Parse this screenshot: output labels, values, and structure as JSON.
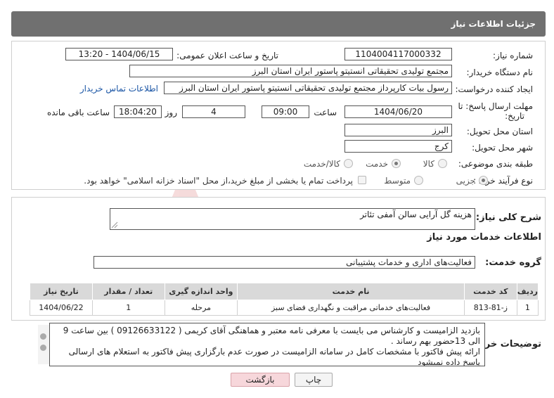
{
  "header": {
    "title": "جزئیات اطلاعات نیاز"
  },
  "form": {
    "need_number_label": "شماره نیاز:",
    "need_number": "1104004117000332",
    "announce_label": "تاریخ و ساعت اعلان عمومی:",
    "announce_value": "1404/06/15 - 13:20",
    "buyer_org_label": "نام دستگاه خریدار:",
    "buyer_org": "مجتمع تولیدی تحقیقاتی انستیتو پاستور ایران استان البرز",
    "requester_label": "ایجاد کننده درخواست:",
    "requester": "رسول بیات کارپرداز مجتمع تولیدی تحقیقاتی انستیتو پاستور ایران استان البرز",
    "contact_link": "اطلاعات تماس خریدار",
    "deadline_label_1": "مهلت ارسال پاسخ: تا",
    "deadline_label_2": "تاریخ:",
    "deadline_date": "1404/06/20",
    "time_label": "ساعت",
    "deadline_time": "09:00",
    "days_value": "4",
    "days_label": "روز و",
    "remaining_time": "18:04:20",
    "remaining_label": "ساعت باقی مانده",
    "province_label": "استان محل تحویل:",
    "province": "البرز",
    "city_label": "شهر محل تحویل:",
    "city": "کرج",
    "category_label": "طبقه بندی موضوعی:",
    "category_options": [
      "کالا",
      "خدمت",
      "کالا/خدمت"
    ],
    "category_selected": "خدمت",
    "process_label": "نوع فرآیند خرید :",
    "process_options": [
      "جزیی",
      "متوسط"
    ],
    "process_selected": "جزیی",
    "payment_note": "پرداخت تمام یا بخشی از مبلغ خرید،از محل \"اسناد خزانه اسلامی\" خواهد بود."
  },
  "summary": {
    "label": "شرح کلی نیاز:",
    "value": "هزینه گل آرایی سالن آمفی تئاتر"
  },
  "services": {
    "section_title": "اطلاعات خدمات مورد نیاز",
    "group_label": "گروه خدمت:",
    "group_value": "فعالیت‌های اداری و خدمات پشتیبانی",
    "columns": [
      "ردیف",
      "کد خدمت",
      "نام خدمت",
      "واحد اندازه گیری",
      "تعداد / مقدار",
      "تاریخ نیاز"
    ],
    "rows": [
      [
        "1",
        "ز-81-813",
        "فعالیت‌های خدماتی مراقبت و نگهداری فضای سبز",
        "مرحله",
        "1",
        "1404/06/22"
      ]
    ]
  },
  "notes": {
    "label": "توضیحات خریدار:",
    "lines": [
      "بازدید الزامیست و کارشناس می بایست با معرفی نامه معتبر و هماهنگی آقای کریمی ( 09126633122 ) بین ساعت 9",
      "الی 13حضور بهم رساند .",
      "ارائه پیش فاکتور با مشخصات کامل در سامانه الزامیست در صورت عدم بارگزاری پیش فاکتور به استعلام های ارسالی",
      "پاسخ داده نمیشود"
    ]
  },
  "buttons": {
    "print": "چاپ",
    "back": "بازگشت"
  },
  "watermark": {
    "text": "AriaTender.neT"
  },
  "colors": {
    "header_bg": "#707070",
    "back_button_bg": "#f7d7db",
    "link": "#1a55a5"
  }
}
